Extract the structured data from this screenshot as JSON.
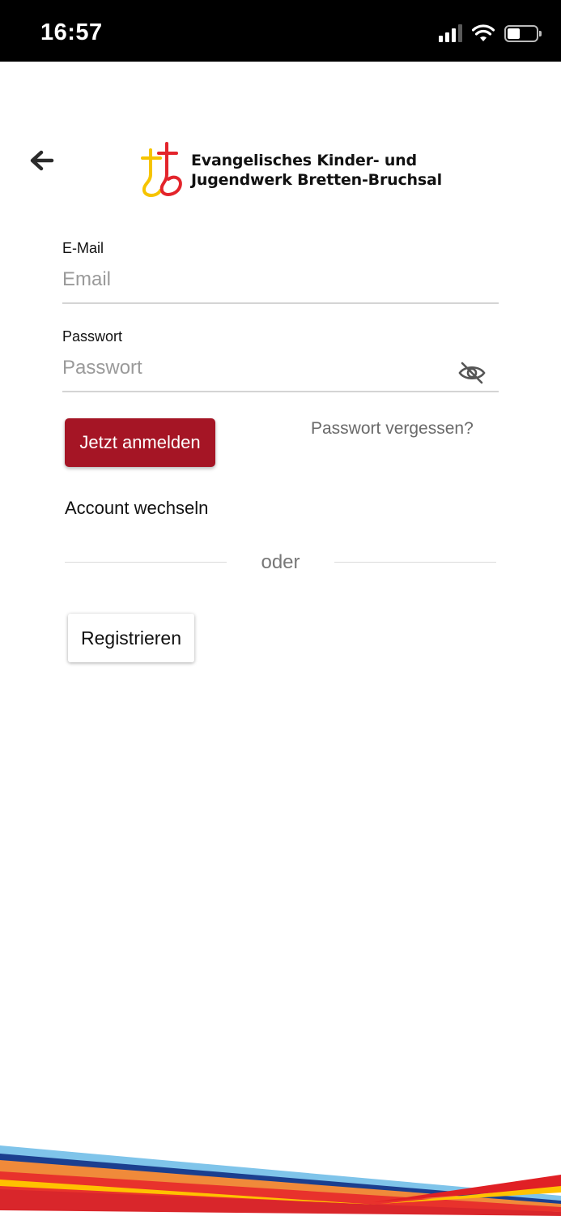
{
  "status_bar": {
    "time": "16:57"
  },
  "header": {
    "back_icon": "arrow-left-icon",
    "logo_line1": "Evangelisches Kinder- und",
    "logo_line2": "Jugendwerk Bretten-Bruchsal"
  },
  "form": {
    "email_label": "E-Mail",
    "email_placeholder": "Email",
    "email_value": "",
    "password_label": "Passwort",
    "password_placeholder": "Passwort",
    "password_value": "",
    "password_toggle_icon": "eye-off-icon"
  },
  "actions": {
    "login_label": "Jetzt anmelden",
    "forgot_label": "Passwort vergessen?",
    "switch_account_label": "Account wechseln",
    "divider_label": "oder",
    "register_label": "Registrieren"
  },
  "colors": {
    "primary": "#a51525",
    "logo_red": "#e3242b",
    "logo_yellow": "#f6c400"
  }
}
